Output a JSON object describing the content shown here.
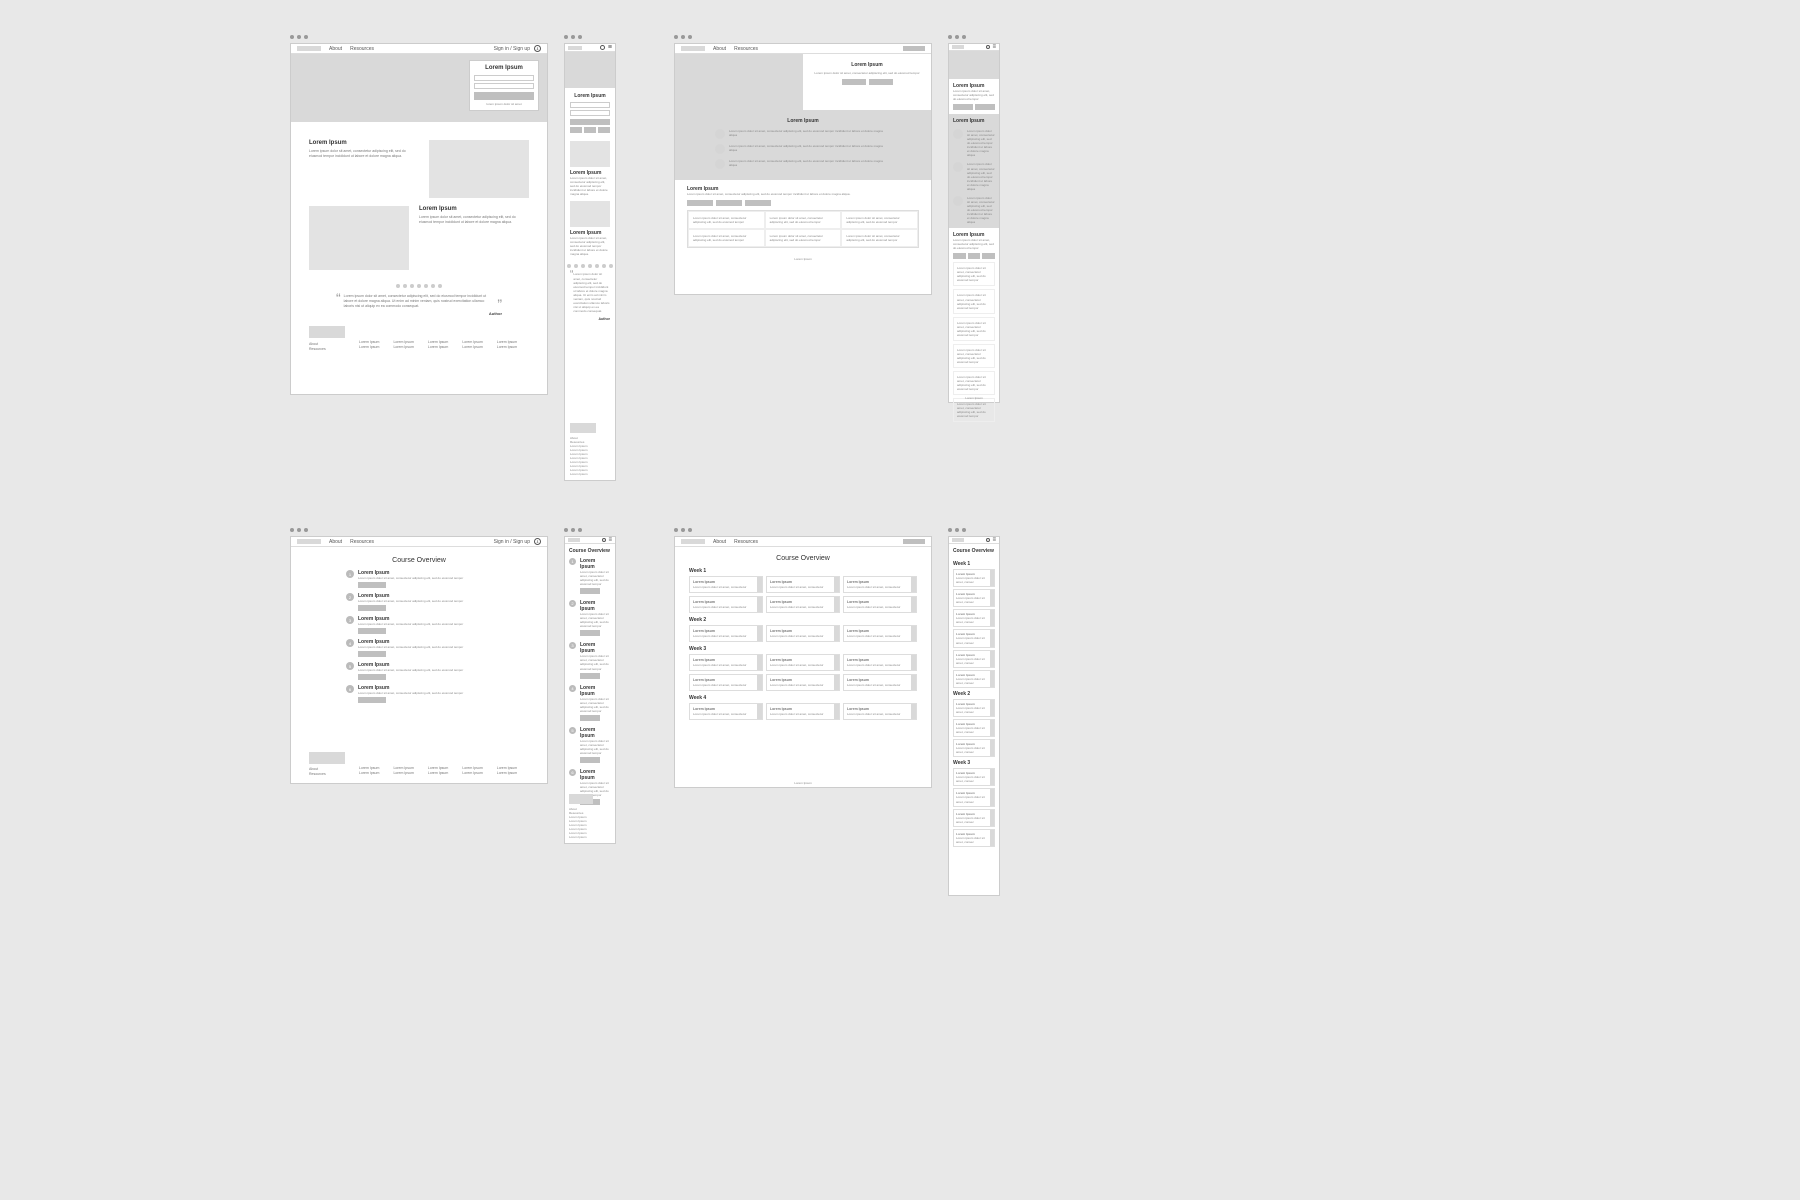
{
  "nav": {
    "about": "About",
    "resources": "Resources",
    "signin": "Sign in / Sign up"
  },
  "lorem": "Lorem Ipsum",
  "author": "Author",
  "body_short": "Lorem ipsum dolor sit amet, consectetur adipiscing elit, sed do eiusmod tempor incididunt ut labore et dolore magna aliqua.",
  "body_long": "Lorem ipsum dolor sit amet, consectetur adipiscing elit, sed do eiusmod tempor incididunt ut labore et dolore magna aliqua. Ut enim ad minim veniam, quis nostrud exercitation ullamco laboris nisi ut aliquip ex ea commodo consequat.",
  "bullet": "Lorem ipsum dolor sit amet, consectetur adipiscing elit, sed do eiusmod tempor incididunt ut labore et dolore magna aliqua",
  "body_tiny": "Lorem ipsum dolor sit amet, consectetur adipiscing elit, sed do eiusmod tempor",
  "card_text": "Lorem ipsum dolor sit amet, consectetur adipiscing elit, sed do eiusmod tempor",
  "footer_link": "Lorem Ipsum",
  "course_overview": "Course Overview",
  "weeks": [
    "Week 1",
    "Week 2",
    "Week 3",
    "Week 4"
  ]
}
